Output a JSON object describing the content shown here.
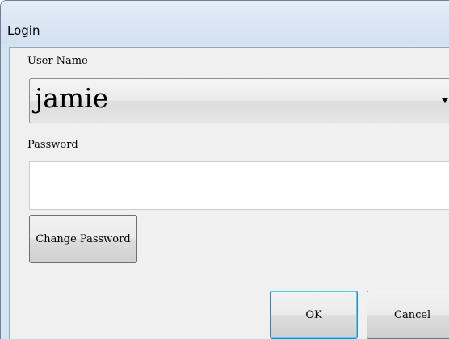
{
  "window": {
    "title": "Login"
  },
  "form": {
    "username_label": "User Name",
    "username_value": "jamie",
    "password_label": "Password",
    "password_value": ""
  },
  "buttons": {
    "change_password": "Change Password",
    "ok": "OK",
    "cancel": "Cancel"
  },
  "colors": {
    "title_bar": "#d6e3f1",
    "client_background": "#f0f0f0",
    "ok_focus_border": "#3c7fb1"
  }
}
